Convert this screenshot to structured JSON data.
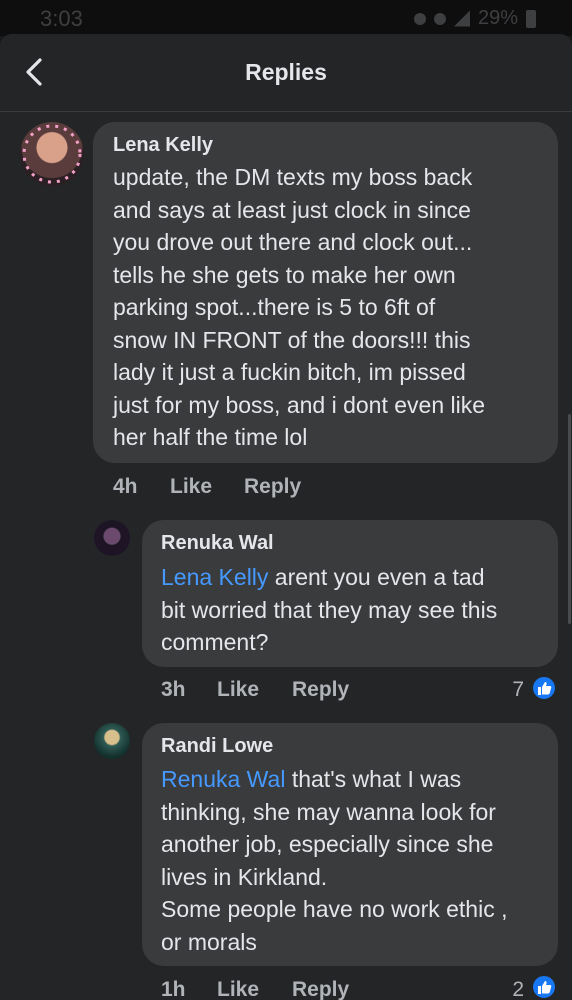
{
  "status_bar": {
    "time": "3:03",
    "battery": "29%"
  },
  "header": {
    "title": "Replies"
  },
  "comments": [
    {
      "author": "Lena Kelly",
      "text": "update, the DM texts my boss back\nand says at least just clock in since\nyou drove out there and clock out...\ntells he she gets to make her own\nparking spot...there is 5 to 6ft of\nsnow IN FRONT of the doors!!! this\nlady it just a fuckin bitch, im pissed\njust for my boss, and i dont even like\nher half the time lol",
      "time": "4h",
      "like_label": "Like",
      "reply_label": "Reply"
    },
    {
      "author": "Renuka Wal",
      "mention": "Lena Kelly",
      "text": " arent you even a tad\nbit worried that they may see this\ncomment?",
      "time": "3h",
      "like_label": "Like",
      "reply_label": "Reply",
      "reaction_count": "7"
    },
    {
      "author": "Randi Lowe",
      "mention": "Renuka Wal",
      "text": "  that's what I was\nthinking, she may wanna look for\nanother job, especially since she\nlives in Kirkland.\nSome people have no work ethic ,\nor morals",
      "time": "1h",
      "like_label": "Like",
      "reply_label": "Reply",
      "reaction_count": "2"
    }
  ],
  "colors": {
    "background": "#242526",
    "bubble": "#3a3b3c",
    "mention": "#4599ff",
    "like_badge": "#1877f2"
  }
}
